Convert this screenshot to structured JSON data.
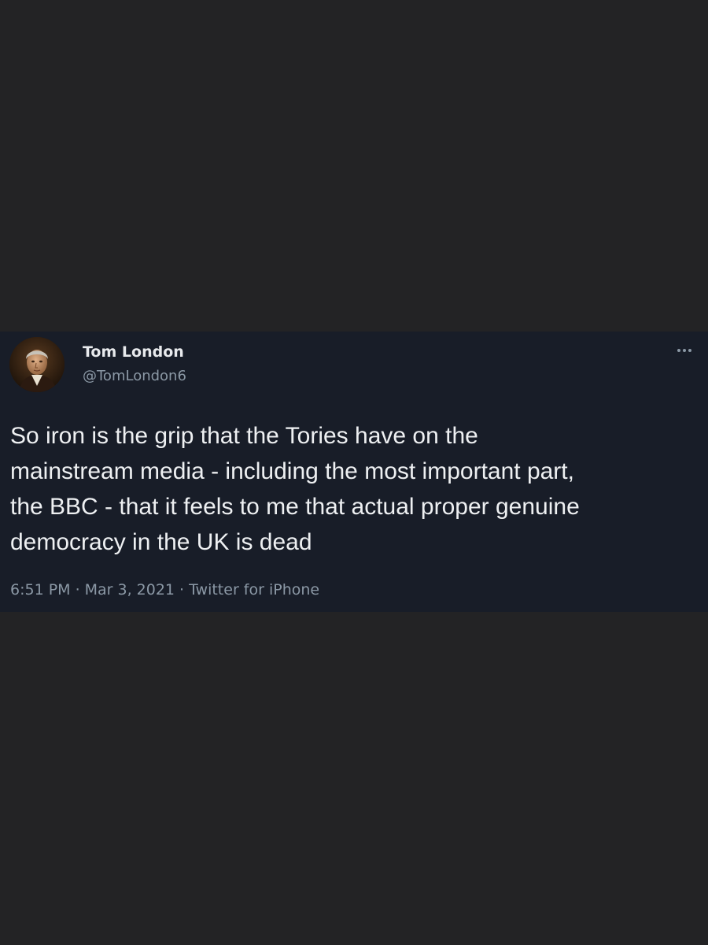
{
  "tweet": {
    "author": {
      "display_name": "Tom London",
      "handle": "@TomLondon6",
      "avatar_icon": "portrait-avatar"
    },
    "more_icon": "more-options-icon",
    "text_lines": [
      "So iron is the grip that the Tories have on the",
      "mainstream media - including the most important part,",
      "the BBC - that it feels to me that actual proper genuine",
      "democracy in the UK is dead"
    ],
    "meta": {
      "time": "6:51 PM",
      "separator": "·",
      "date": "Mar 3, 2021",
      "source": "Twitter for iPhone"
    }
  },
  "colors": {
    "page_background": "#232325",
    "card_background": "#181d28",
    "primary_text": "#eef0f2",
    "secondary_text": "#8b98a5"
  }
}
